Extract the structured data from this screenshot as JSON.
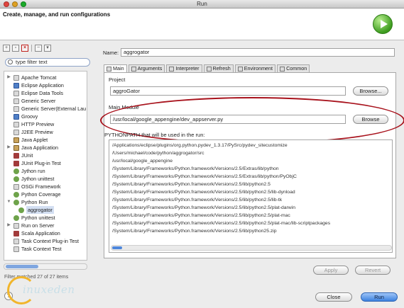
{
  "window": {
    "title": "Run"
  },
  "banner": {
    "title": "Create, manage, and run configurations",
    "run_icon": "run-icon"
  },
  "toolbar": {
    "icons": [
      "new-config-icon",
      "duplicate-icon",
      "delete-icon",
      "collapse-all-icon",
      "filter-icon"
    ]
  },
  "filter": {
    "value": "type filter text"
  },
  "tree": {
    "items": [
      {
        "label": "Apache Tomcat",
        "icon": "tomcat-icon",
        "expandable": true
      },
      {
        "label": "Eclipse Application",
        "icon": "eclipse-icon",
        "expandable": false
      },
      {
        "label": "Eclipse Data Tools",
        "icon": "data-tools-icon",
        "expandable": false
      },
      {
        "label": "Generic Server",
        "icon": "server-icon",
        "expandable": false
      },
      {
        "label": "Generic Server(External Lau",
        "icon": "server-icon",
        "expandable": false
      },
      {
        "label": "Groovy",
        "icon": "groovy-icon",
        "expandable": false
      },
      {
        "label": "HTTP Preview",
        "icon": "http-icon",
        "expandable": false
      },
      {
        "label": "J2EE Preview",
        "icon": "j2ee-icon",
        "expandable": false
      },
      {
        "label": "Java Applet",
        "icon": "applet-icon",
        "expandable": false
      },
      {
        "label": "Java Application",
        "icon": "java-icon",
        "expandable": true
      },
      {
        "label": "JUnit",
        "icon": "junit-icon",
        "expandable": false
      },
      {
        "label": "JUnit Plug-in Test",
        "icon": "junit-icon",
        "expandable": false
      },
      {
        "label": "Jython run",
        "icon": "python-icon",
        "expandable": false
      },
      {
        "label": "Jython unittest",
        "icon": "python-icon",
        "expandable": false
      },
      {
        "label": "OSGi Framework",
        "icon": "osgi-icon",
        "expandable": false
      },
      {
        "label": "Python Coverage",
        "icon": "python-icon",
        "expandable": false
      },
      {
        "label": "Python Run",
        "icon": "python-icon",
        "expandable": true,
        "expanded": true
      },
      {
        "label": "aggrogator",
        "icon": "python-icon",
        "child": true,
        "selected": true
      },
      {
        "label": "Python unittest",
        "icon": "python-icon",
        "expandable": false
      },
      {
        "label": "Run on Server",
        "icon": "server-icon",
        "expandable": true
      },
      {
        "label": "Scala Application",
        "icon": "scala-icon",
        "expandable": false
      },
      {
        "label": "Task Context Plug-in Test",
        "icon": "task-icon",
        "expandable": false
      },
      {
        "label": "Task Context Test",
        "icon": "task-icon",
        "expandable": false
      }
    ],
    "status": "Filter matched 27 of 27 items"
  },
  "name": {
    "label": "Name:",
    "value": "aggrogator"
  },
  "tabs": [
    {
      "label": "Main",
      "icon": "main-tab-icon",
      "active": true
    },
    {
      "label": "Arguments",
      "icon": "arguments-icon"
    },
    {
      "label": "Interpreter",
      "icon": "interpreter-icon"
    },
    {
      "label": "Refresh",
      "icon": "refresh-icon"
    },
    {
      "label": "Environment",
      "icon": "environment-icon"
    },
    {
      "label": "Common",
      "icon": "common-icon"
    }
  ],
  "project": {
    "label": "Project",
    "value": "aggroGator",
    "button": "Browse..."
  },
  "main_module": {
    "label": "Main Module",
    "value": "/usr/local/google_appengine/dev_appserver.py",
    "button": "Browse"
  },
  "pythonpath": {
    "label": "PYTHONPATH that will be used in the run:",
    "entries": [
      "/Applications/eclipse/plugins/org.python.pydev_1.3.17/PySrc/pydev_sitecustomize",
      "/Users/michael/code/python/aggrogator/src",
      "/usr/local/google_appengine",
      "/System/Library/Frameworks/Python.framework/Versions/2.5/Extras/lib/python",
      "/System/Library/Frameworks/Python.framework/Versions/2.5/Extras/lib/python/PyObjC",
      "/System/Library/Frameworks/Python.framework/Versions/2.5/lib/python2.5",
      "/System/Library/Frameworks/Python.framework/Versions/2.5/lib/python2.5/lib-dynload",
      "/System/Library/Frameworks/Python.framework/Versions/2.5/lib/python2.5/lib-tk",
      "/System/Library/Frameworks/Python.framework/Versions/2.5/lib/python2.5/plat-darwin",
      "/System/Library/Frameworks/Python.framework/Versions/2.5/lib/python2.5/plat-mac",
      "/System/Library/Frameworks/Python.framework/Versions/2.5/lib/python2.5/plat-mac/lib-scriptpackages",
      "/System/Library/Frameworks/Python.framework/Versions/2.5/lib/python25.zip"
    ]
  },
  "actions": {
    "apply": "Apply",
    "revert": "Revert",
    "close": "Close",
    "run": "Run"
  },
  "watermark": {
    "text": "inuxeden"
  },
  "colors": {
    "highlight": "#a8121c",
    "accent": "#3d82df",
    "run_green": "#3d9c1f"
  }
}
